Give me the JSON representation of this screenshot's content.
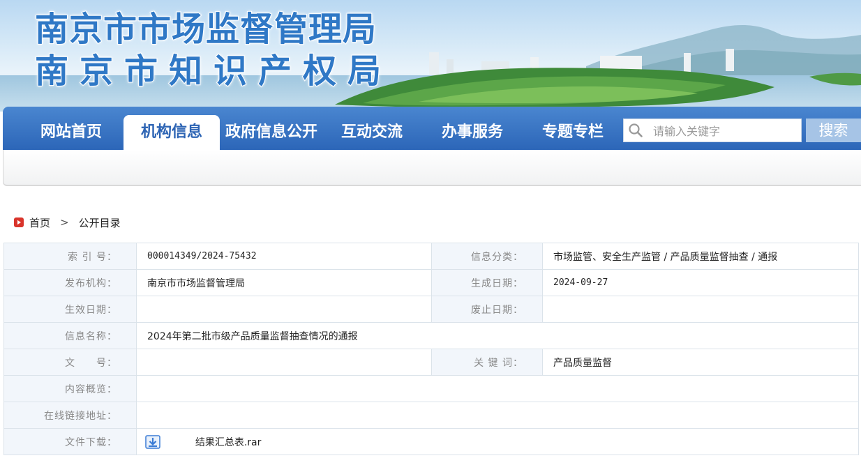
{
  "banner": {
    "title_line1": "南京市市场监督管理局",
    "title_line2": "南京市知识产权局"
  },
  "nav": {
    "items": [
      {
        "label": "网站首页"
      },
      {
        "label": "机构信息",
        "active": true
      },
      {
        "label": "政府信息公开"
      },
      {
        "label": "互动交流"
      },
      {
        "label": "办事服务"
      },
      {
        "label": "专题专栏"
      }
    ],
    "search_placeholder": "请输入关键字",
    "search_button": "搜索"
  },
  "breadcrumb": {
    "home": "首页",
    "separator": ">",
    "current": "公开目录"
  },
  "info": {
    "index_label": "索 引 号：",
    "index_value": "000014349/2024-75432",
    "category_label": "信息分类：",
    "category_value": "市场监管、安全生产监管 / 产品质量监督抽查 / 通报",
    "publisher_label": "发布机构：",
    "publisher_value": "南京市市场监督管理局",
    "created_label": "生成日期：",
    "created_value": "2024-09-27",
    "effective_label": "生效日期：",
    "effective_value": "",
    "abolish_label": "废止日期：",
    "abolish_value": "",
    "name_label": "信息名称：",
    "name_value": "2024年第二批市级产品质量监督抽查情况的通报",
    "docno_label": "文　　号：",
    "docno_value": "",
    "keywords_label": "关 键 词：",
    "keywords_value": "产品质量监督",
    "summary_label": "内容概览：",
    "summary_value": "",
    "link_label": "在线链接地址：",
    "link_value": "",
    "download_label": "文件下载：",
    "download_file": "结果汇总表.rar"
  },
  "colors": {
    "nav_blue": "#2c66b8",
    "title_blue": "#2f78c6",
    "label_bg": "#f2f6fb",
    "search_button": "#a6c4e6"
  }
}
